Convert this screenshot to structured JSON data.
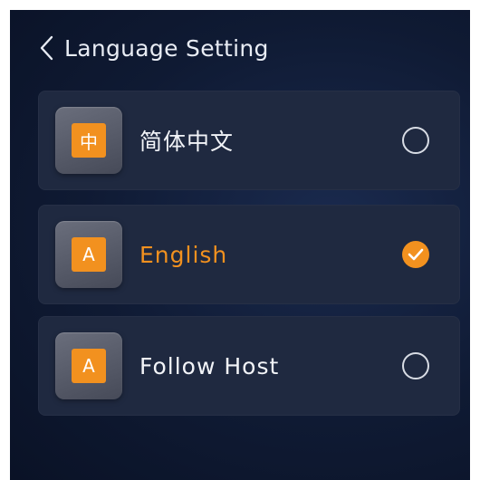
{
  "header": {
    "title": "Language Setting",
    "back_icon": "chevron-left-icon"
  },
  "options": [
    {
      "icon_glyph": "中",
      "label": "简体中文",
      "selected": false
    },
    {
      "icon_glyph": "A",
      "label": "English",
      "selected": true
    },
    {
      "icon_glyph": "A",
      "label": "Follow Host",
      "selected": false
    }
  ],
  "colors": {
    "accent": "#f2911f",
    "background": "#0f1a33",
    "card": "#1f2940",
    "text": "#f2f4f8"
  }
}
